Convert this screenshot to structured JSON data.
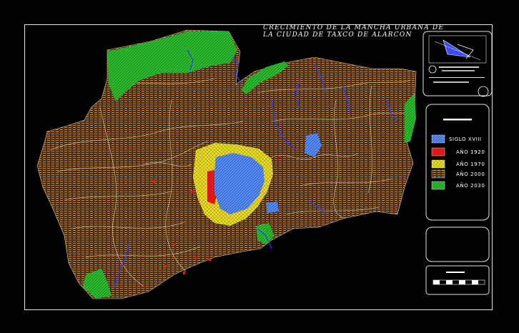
{
  "map": {
    "title_line_1": "CRECIMIENTO DE LA MANCHA URBANA DE",
    "title_line_2": "LA CIUDAD DE TAXCO DE ALARCON",
    "colors": {
      "background": "#000000",
      "frame": "#e6e6e6",
      "terrain_hatch": "#c8803a",
      "terrain_fill": "#5a3c22",
      "contours": "#f0dca8",
      "streams": "#2a3cff",
      "green_zone": "#22b826",
      "yellow_zone": "#f2ea2a",
      "red_zone": "#e81818",
      "blue_zone": "#3a7ee8"
    }
  },
  "legend": {
    "items": [
      {
        "label": "SIGLO XVIII",
        "color": "#3a6fe0",
        "pattern": "blue-hatch"
      },
      {
        "label": "AÑO 1920",
        "color": "#e01818",
        "pattern": "red-solid"
      },
      {
        "label": "AÑO 1970",
        "color": "#f2ea2a",
        "pattern": "yellow-cross"
      },
      {
        "label": "AÑO 2000",
        "color": "#d08a3a",
        "pattern": "orange-hatch"
      },
      {
        "label": "AÑO 2030",
        "color": "#22c02a",
        "pattern": "green-solid"
      }
    ]
  },
  "title_block": {
    "logo_icon": "compass-north-arrow-icon",
    "institution_text": "",
    "scale_label": "ESCALA",
    "scale_bar_icon": "scale-bar-icon"
  }
}
